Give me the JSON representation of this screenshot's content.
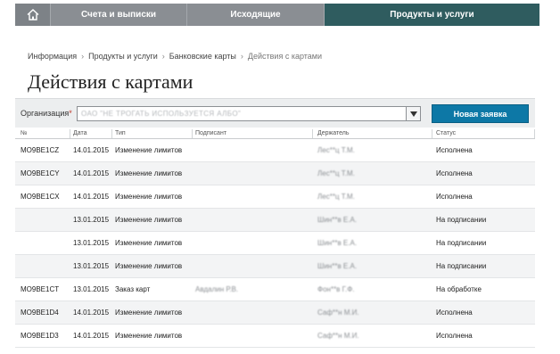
{
  "nav": {
    "home_icon": "home-icon",
    "tabs": [
      {
        "label": "Счета и выписки"
      },
      {
        "label": "Исходящие"
      },
      {
        "label": "Продукты и услуги"
      }
    ]
  },
  "breadcrumb": [
    "Информация",
    "Продукты и услуги",
    "Банковские карты",
    "Действия с картами"
  ],
  "page_title": "Действия с картами",
  "filter": {
    "org_label": "Организация",
    "required_mark": "*",
    "org_value": "ОАО \"НЕ ТРОГАТЬ ИСПОЛЬЗУЕТСЯ АЛБО\"",
    "new_button": "Новая заявка"
  },
  "table": {
    "headers": [
      "№",
      "Дата",
      "Тип",
      "Подписант",
      "Держатель",
      "Статус"
    ],
    "rows": [
      {
        "num": "MO9BE1CZ",
        "date": "14.01.2015",
        "type": "Изменение лимитов",
        "signer": "",
        "holder": "Лес**ц Т.М.",
        "status": "Исполнена"
      },
      {
        "num": "MO9BE1CY",
        "date": "14.01.2015",
        "type": "Изменение лимитов",
        "signer": "",
        "holder": "Лес**ц Т.М.",
        "status": "Исполнена"
      },
      {
        "num": "MO9BE1CX",
        "date": "14.01.2015",
        "type": "Изменение лимитов",
        "signer": "",
        "holder": "Лес**ц Т.М.",
        "status": "Исполнена"
      },
      {
        "num": "",
        "date": "13.01.2015",
        "type": "Изменение лимитов",
        "signer": "",
        "holder": "Шин**в Е.А.",
        "status": "На подписании"
      },
      {
        "num": "",
        "date": "13.01.2015",
        "type": "Изменение лимитов",
        "signer": "",
        "holder": "Шин**в Е.А.",
        "status": "На подписании"
      },
      {
        "num": "",
        "date": "13.01.2015",
        "type": "Изменение лимитов",
        "signer": "",
        "holder": "Шин**в Е.А.",
        "status": "На подписании"
      },
      {
        "num": "MO9BE1CT",
        "date": "13.01.2015",
        "type": "Заказ карт",
        "signer": "Авдалин Р.В.",
        "holder": "Фон**в Г.Ф.",
        "status": "На обработке"
      },
      {
        "num": "MO9BE1D4",
        "date": "14.01.2015",
        "type": "Изменение лимитов",
        "signer": "",
        "holder": "Саф**н М.И.",
        "status": "Исполнена"
      },
      {
        "num": "MO9BE1D3",
        "date": "14.01.2015",
        "type": "Изменение лимитов",
        "signer": "",
        "holder": "Саф**н М.И.",
        "status": "Исполнена"
      }
    ]
  }
}
